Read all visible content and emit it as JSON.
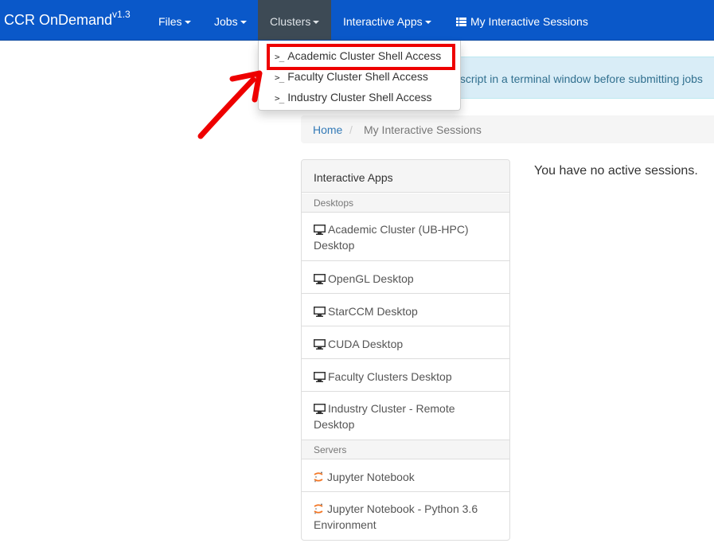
{
  "navbar": {
    "brand": "CCR OnDemand",
    "version": "v1.3",
    "items": [
      {
        "label": "Files"
      },
      {
        "label": "Jobs"
      },
      {
        "label": "Clusters"
      },
      {
        "label": "Interactive Apps"
      },
      {
        "label": "My Interactive Sessions"
      }
    ],
    "color": "#0a58c9"
  },
  "clusters_menu": {
    "items": [
      {
        "label": "Academic Cluster Shell Access",
        "icon": "terminal-icon"
      },
      {
        "label": "Faculty Cluster Shell Access",
        "icon": "terminal-icon"
      },
      {
        "label": "Industry Cluster Shell Access",
        "icon": "terminal-icon"
      }
    ],
    "prompt": ">_"
  },
  "alert": {
    "text": "s script in a terminal window before submitting jobs"
  },
  "breadcrumb": {
    "home": "Home",
    "separator": "/",
    "current": "My Interactive Sessions"
  },
  "apps_panel": {
    "title": "Interactive Apps",
    "groups": [
      {
        "label": "Desktops",
        "items": [
          {
            "label": "Academic Cluster (UB-HPC) Desktop",
            "icon": "monitor-icon"
          },
          {
            "label": "OpenGL Desktop",
            "icon": "monitor-icon"
          },
          {
            "label": "StarCCM Desktop",
            "icon": "monitor-icon"
          },
          {
            "label": "CUDA Desktop",
            "icon": "monitor-icon"
          },
          {
            "label": "Faculty Clusters Desktop",
            "icon": "monitor-icon"
          },
          {
            "label": "Industry Cluster - Remote Desktop",
            "icon": "monitor-icon"
          }
        ]
      },
      {
        "label": "Servers",
        "items": [
          {
            "label": "Jupyter Notebook",
            "icon": "jupyter-icon"
          },
          {
            "label": "Jupyter Notebook - Python 3.6 Environment",
            "icon": "jupyter-icon"
          }
        ]
      }
    ]
  },
  "sessions": {
    "empty_message": "You have no active sessions."
  },
  "annotation": {
    "color": "#ee0000"
  }
}
